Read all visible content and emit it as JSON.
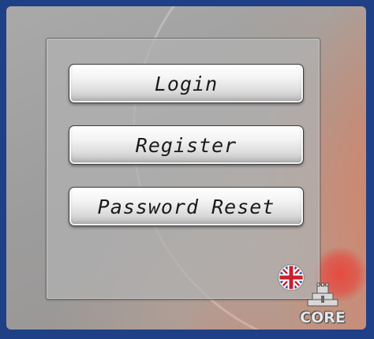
{
  "menu": {
    "login_label": "Login",
    "register_label": "Register",
    "password_reset_label": "Password Reset"
  },
  "language": {
    "icon": "uk-flag-icon"
  },
  "branding": {
    "logo_text": "CORE"
  },
  "colors": {
    "background": "#1f3f86",
    "panel": "#b2b2b2",
    "button_text": "#1a1a1a",
    "accent_glow": "#e8463c"
  }
}
